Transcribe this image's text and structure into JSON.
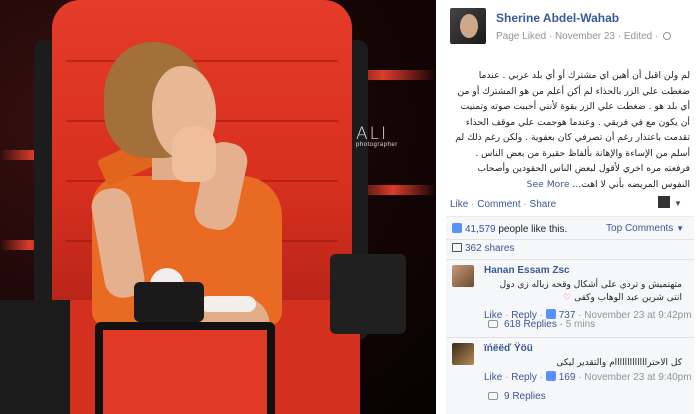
{
  "photo": {
    "watermark_main": "ALI",
    "watermark_sub": "photographer"
  },
  "post": {
    "page_name": "Sherine Abdel-Wahab",
    "meta_status": "Page Liked",
    "meta_dot1": "·",
    "meta_date": "November 23",
    "meta_dot2": "·",
    "meta_edited": "Edited ·",
    "body": "لم ولن اقبل أن أهين اي مشترك أو أي بلد عربي . عندما ضغطت علي الزر بالحذاء لم أكن أعلم من هو المشترك أو من أي بلد هو . ضغطت علي الزر بقوة لأنني أحببت صوته وتمنيت أن يكون مع في فريقي . وعندما هوجمت علي موقف الحذاء تقدمت باعتذار رغم أن تصرفي كان بعفوية . ولكن رغم ذلك لم أسلم من الإساءة والإهانة بألفاظ حقيرة من بعض الناس . فرفعته مره اخري لأقول لبعض الناس الحقودين وأصحاب النفوس المريضه بأني لا اهت...",
    "see_more": "See More"
  },
  "actions": {
    "like": "Like",
    "dot": "·",
    "comment": "Comment",
    "share": "Share"
  },
  "ufi": {
    "likes_count": "41,579",
    "likes_suffix": "people like this.",
    "top_comments": "Top Comments",
    "shares": "362 shares"
  },
  "comments": [
    {
      "name": "Hanan Essam Zsc",
      "text": "متهتميش و تردي على أشكال وقحه زباله زى دول انتى شرين عبد الوهاب وكفى",
      "like": "Like",
      "reply": "Reply",
      "likes": "737",
      "time": "November 23 at 9:42pm",
      "replies": "618 Replies",
      "replies_time": "5 mins"
    },
    {
      "name": "ïńëëď Ÿöü",
      "text": "كل الاحترااااااااااااام والتقدير ليكى",
      "like": "Like",
      "reply": "Reply",
      "likes": "169",
      "time": "November 23 at 9:40pm",
      "replies": "9 Replies"
    }
  ],
  "colors": {
    "fb_link": "#3b5998",
    "meta_gray": "#90949c",
    "chair_red": "#e43c28",
    "dress_orange": "#e96a22"
  }
}
